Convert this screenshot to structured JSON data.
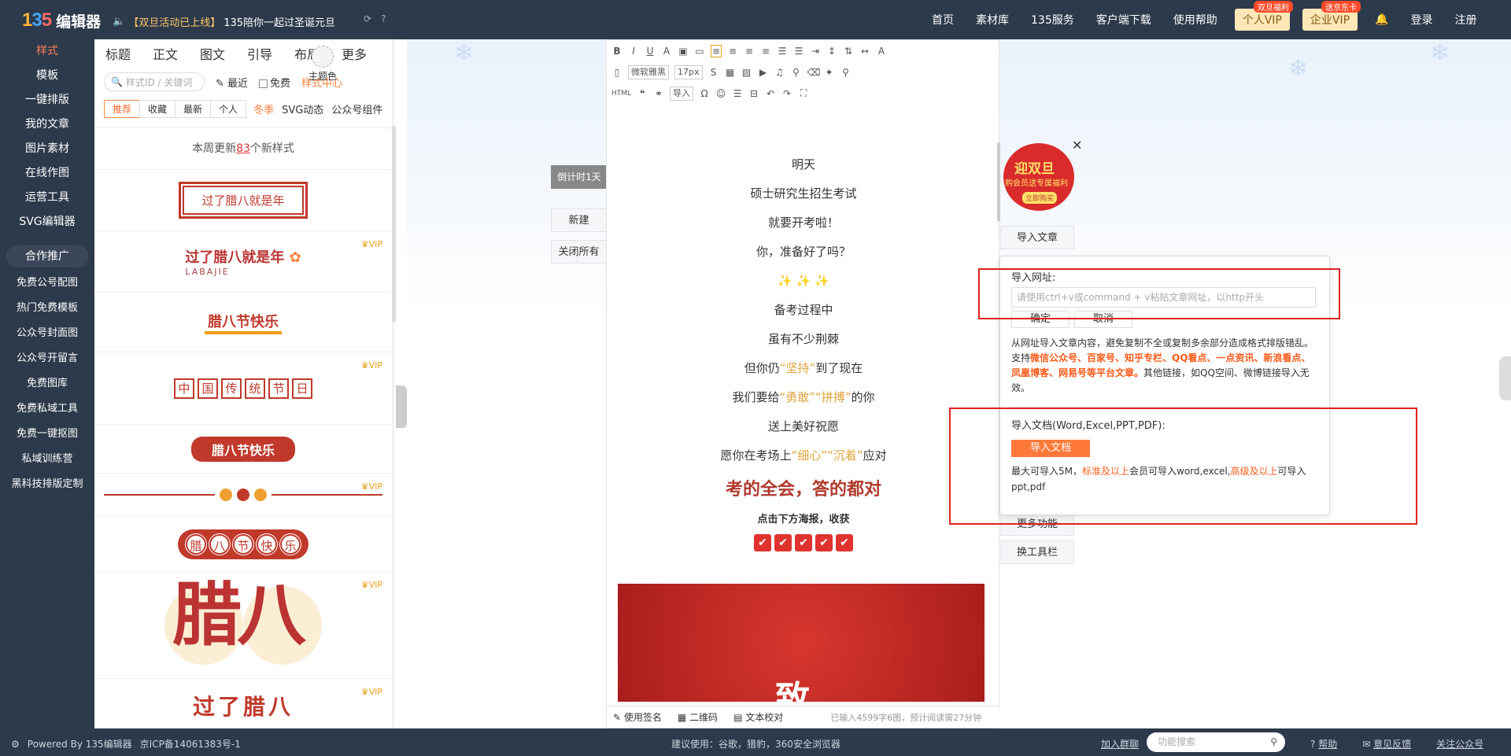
{
  "app": {
    "logo": "135",
    "name": "编辑器"
  },
  "notice": {
    "bracket": "【双旦活动已上线】",
    "text": "135陪你一起过圣诞元旦"
  },
  "nav": {
    "items": [
      "首页",
      "素材库",
      "135服务",
      "客户端下载",
      "使用帮助"
    ],
    "vip_personal": "个人VIP",
    "vip_personal_tag": "双旦福利",
    "vip_enterprise": "企业VIP",
    "vip_enterprise_tag": "送京东卡",
    "login": "登录",
    "register": "注册"
  },
  "left_nav": {
    "primary": [
      "样式",
      "模板",
      "一键排版",
      "我的文章",
      "图片素材",
      "在线作图",
      "运营工具",
      "SVG编辑器"
    ],
    "promo_header": "合作推广",
    "secondary": [
      "免费公号配图",
      "热门免费模板",
      "公众号封面图",
      "公众号开留言",
      "免费图库",
      "免费私域工具",
      "免费一键抠图",
      "私域训练营",
      "黑科技排版定制"
    ]
  },
  "style_panel": {
    "tabs": [
      "标题",
      "正文",
      "图文",
      "引导",
      "布局",
      "更多"
    ],
    "theme_label": "主题色",
    "search_placeholder": "样式ID / 关键词",
    "recent": "最近",
    "free": "免费",
    "style_center": "样式中心",
    "filters": [
      "推荐",
      "收藏",
      "最新",
      "个人"
    ],
    "filter_links": [
      "冬季",
      "SVG动态",
      "公众号组件"
    ],
    "update_prefix": "本周更新",
    "update_count": "83",
    "update_suffix": "个新样式",
    "vip_label": "VIP",
    "cards": {
      "c1": "过了腊八就是年",
      "c2_title": "过了腊八就是年",
      "c2_sub": "LABAJIE",
      "c3": "腊八节快乐",
      "c4": [
        "中",
        "国",
        "传",
        "统",
        "节",
        "日"
      ],
      "c5": "腊八节快乐",
      "c7": [
        "腊",
        "八",
        "节",
        "快",
        "乐"
      ],
      "c8": "腊八",
      "c9": "过了腊八"
    }
  },
  "side_buttons": {
    "countdown": "倒计时1天",
    "new": "新建",
    "close_all": "关闭所有"
  },
  "toolbar": {
    "font": "微软雅黑",
    "size": "17px",
    "html": "HTML",
    "import": "导入"
  },
  "article": {
    "lines": [
      "明天",
      "硕士研究生招生考试",
      "就要开考啦！",
      "你，准备好了吗？"
    ],
    "sparkles": "✨ ✨ ✨",
    "lines2": [
      "备考过程中",
      "虽有不少荆棘"
    ],
    "l_persist": [
      "但你仍",
      "“坚持”",
      "到了现在"
    ],
    "l_brave": [
      "我们要给",
      "“勇敢”",
      "“拼搏”",
      "的你"
    ],
    "l_wish": "送上美好祝愿",
    "l_careful": [
      "愿你在考场上",
      "“细心”",
      "“沉着”",
      "应对"
    ],
    "big": "考的全会，答的都对",
    "small": "点击下方海报，收获",
    "poster_char": "致"
  },
  "statusbar": {
    "signature": "使用签名",
    "qrcode": "二维码",
    "proofread": "文本校对",
    "count": "已输入4599字6图，预计阅读需27分钟"
  },
  "promo": {
    "title": "迎双旦",
    "sub": "购会员送专属福利",
    "cta": "立即购买"
  },
  "right_buttons": {
    "import_article": "导入文章",
    "more": "更多功能",
    "toolbar": "换工具栏"
  },
  "import_dialog": {
    "url_label": "导入网址:",
    "url_placeholder": "请使用ctrl+v或command + v粘贴文章网址，以http开头",
    "confirm": "确定",
    "cancel": "取消",
    "desc_a": "从网址导入文章内容，避免复制不全或复制多余部分造成格式排版错乱。支持",
    "desc_platforms": "微信公众号、百家号、知乎专栏、QQ看点、一点资讯、新浪看点、凤凰博客、网易号等平台文章。",
    "desc_b": "其他链接，如QQ空间、微博链接导入无效。",
    "doc_label": "导入文档(Word,Excel,PPT,PDF):",
    "doc_button": "导入文档",
    "doc_a": "最大可导入5M，",
    "doc_b": "标准及以上",
    "doc_c": "会员可导入word,excel,",
    "doc_d": "高级及以上",
    "doc_e": "可导入ppt,pdf"
  },
  "footer": {
    "powered": "Powered By 135编辑器",
    "icp": "京ICP备14061383号-1",
    "browser": "建议使用：谷歌，猎豹，360安全浏览器",
    "join": "加入群聊",
    "search_placeholder": "功能搜索",
    "help": "帮助",
    "feedback": "意见反馈",
    "follow": "关注公众号"
  },
  "colors": {
    "nav_bg": "#2d3a4b",
    "accent": "#ff7e3a",
    "vip_gold": "#ffe7b8",
    "red_box": "#e02020"
  }
}
